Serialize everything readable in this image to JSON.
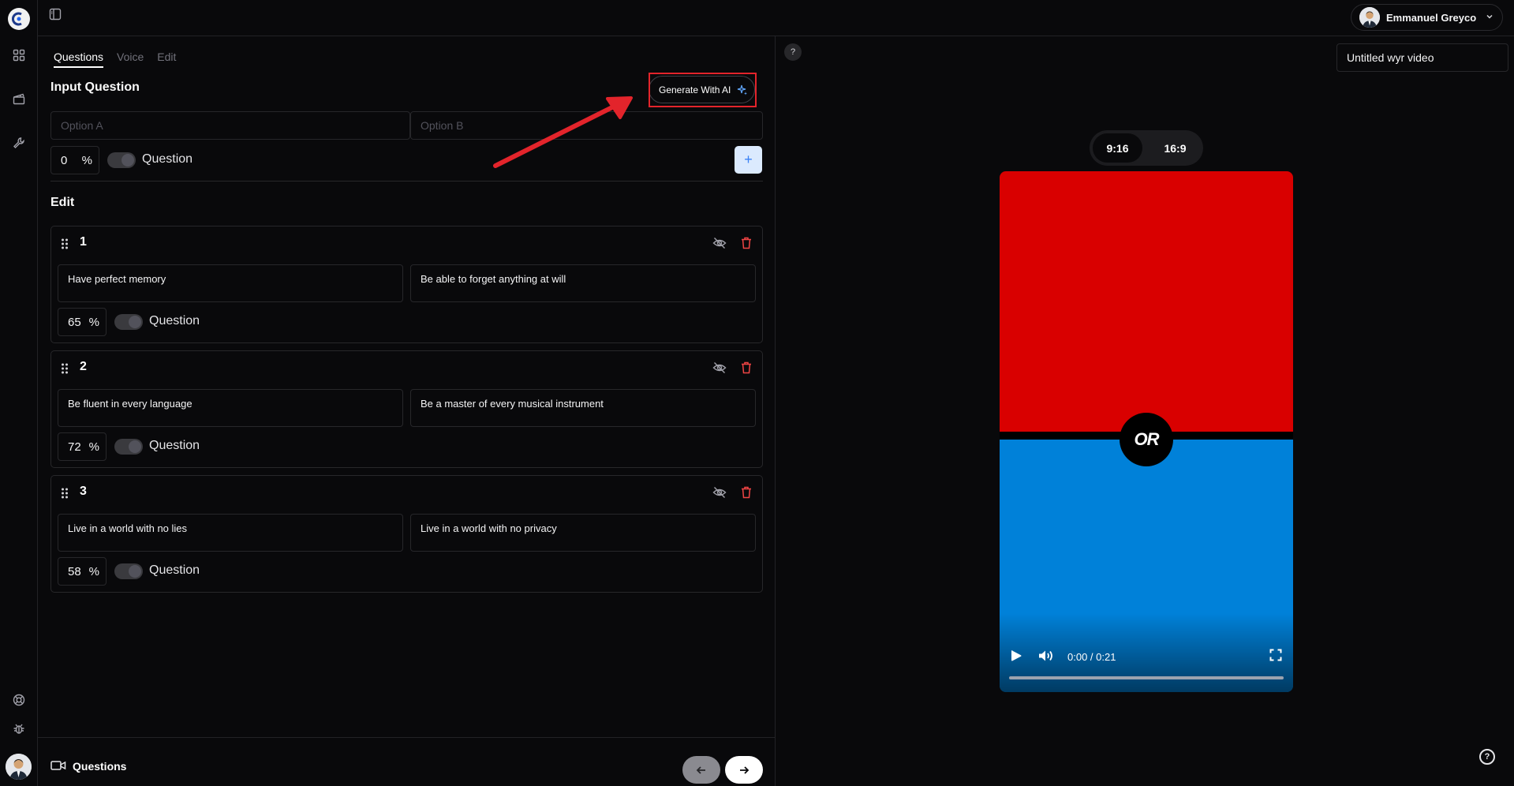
{
  "user": {
    "name": "Emmanuel Greyco"
  },
  "tabs": [
    "Questions",
    "Voice",
    "Edit"
  ],
  "input_section": {
    "heading": "Input Question",
    "generate_label": "Generate With AI",
    "option_a_placeholder": "Option A",
    "option_b_placeholder": "Option B",
    "percent": "0",
    "percent_sign": "%",
    "question_label": "Question",
    "add_label": "+"
  },
  "edit_section": {
    "heading": "Edit",
    "questions": [
      {
        "num": "1",
        "option_a": "Have perfect memory",
        "option_b": "Be able to forget anything at will",
        "percent": "65",
        "percent_sign": "%",
        "question_label": "Question"
      },
      {
        "num": "2",
        "option_a": "Be fluent in every language",
        "option_b": "Be a master of every musical instrument",
        "percent": "72",
        "percent_sign": "%",
        "question_label": "Question"
      },
      {
        "num": "3",
        "option_a": "Live in a world with no lies",
        "option_b": "Live in a world with no privacy",
        "percent": "58",
        "percent_sign": "%",
        "question_label": "Question"
      }
    ]
  },
  "footer": {
    "step_label": "Questions"
  },
  "preview": {
    "help": "?",
    "video_title": "Untitled wyr video",
    "ratios": [
      "9:16",
      "16:9"
    ],
    "selected_ratio": "9:16",
    "or_label": "OR",
    "time": "0:00 / 0:21",
    "progress": 0,
    "top_color": "#d90000",
    "bottom_color": "#0081d9"
  },
  "colors": {
    "accent_red": "#e3242b",
    "delete": "#ef4444",
    "add_button": "#dbeafe"
  }
}
